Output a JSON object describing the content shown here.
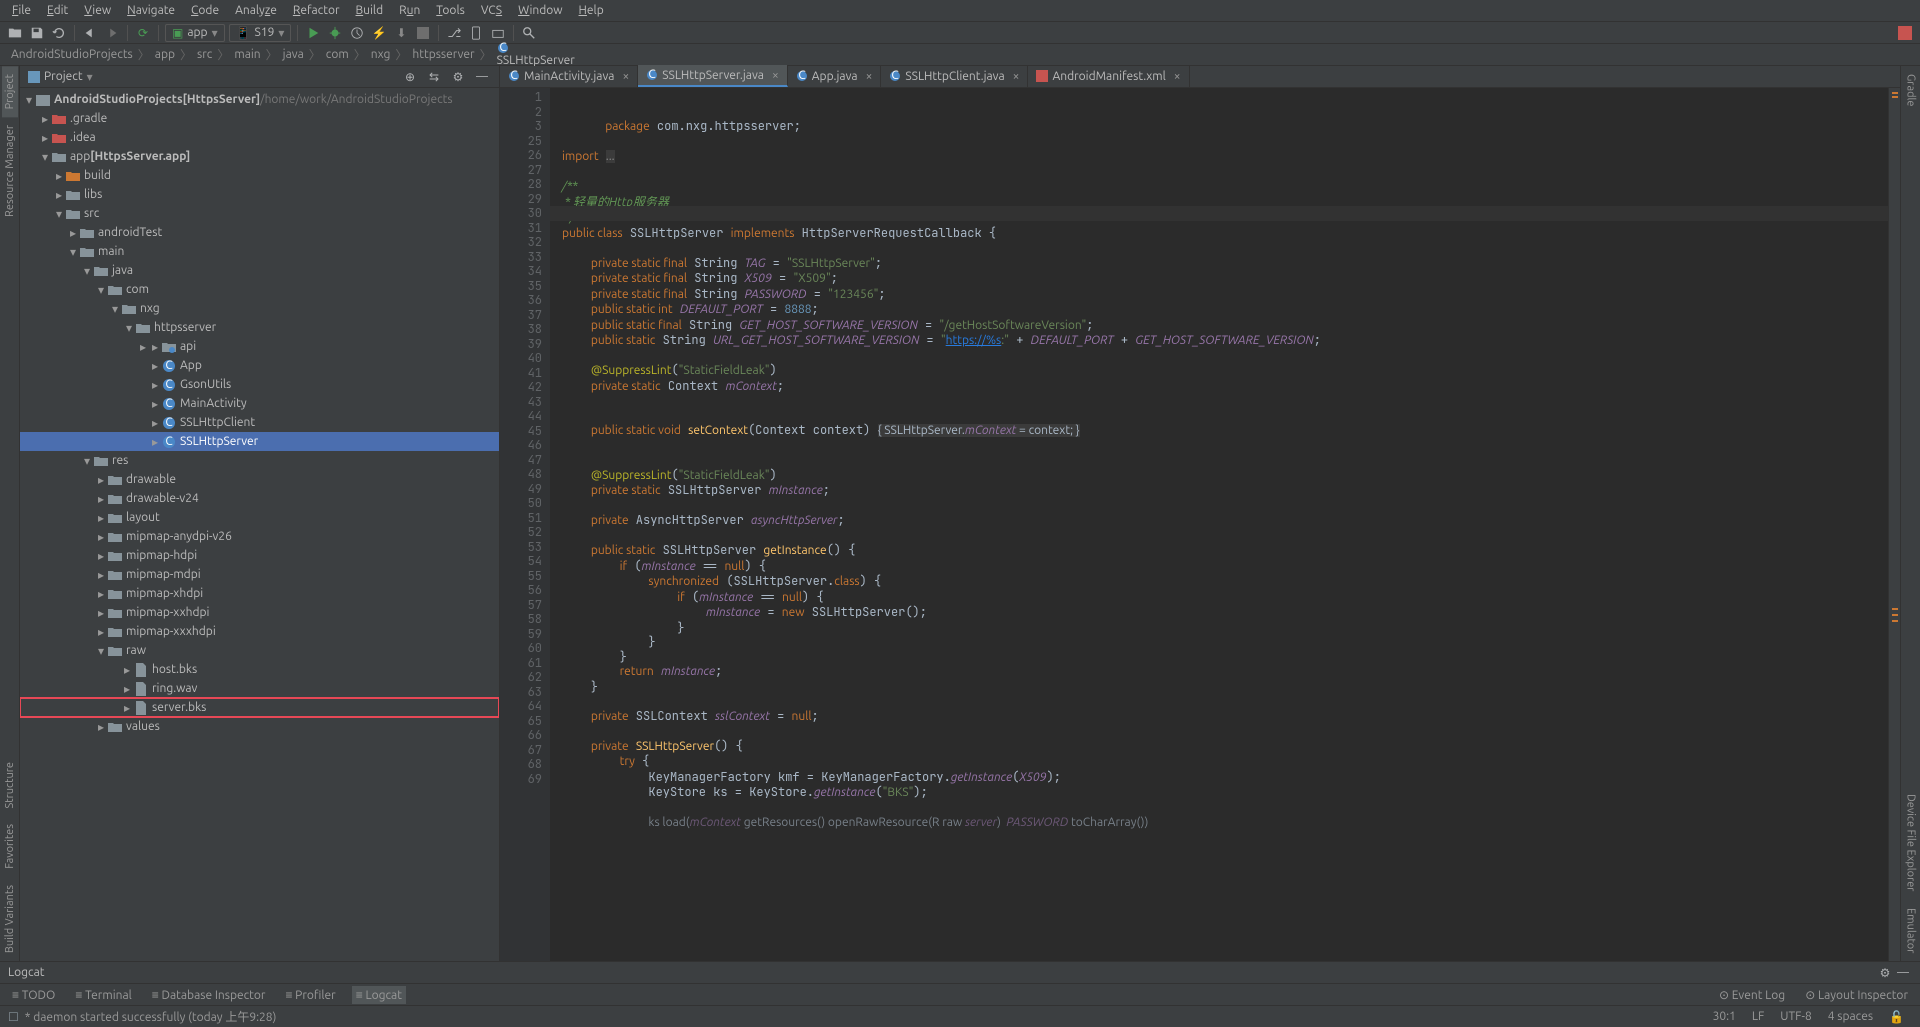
{
  "menu": [
    "File",
    "Edit",
    "View",
    "Navigate",
    "Code",
    "Analyze",
    "Refactor",
    "Build",
    "Run",
    "Tools",
    "VCS",
    "Window",
    "Help"
  ],
  "toolbar": {
    "run_config1": "app",
    "run_config2": "S19"
  },
  "breadcrumb": [
    "AndroidStudioProjects",
    "app",
    "src",
    "main",
    "java",
    "com",
    "nxg",
    "httpsserver",
    "SSLHttpServer"
  ],
  "project_panel": {
    "title": "Project",
    "root": {
      "label": "AndroidStudioProjects",
      "tag": "[HttpsServer]",
      "path": "/home/work/AndroidStudioProjects"
    },
    "tree": [
      {
        "d": 1,
        "t": "fex",
        "l": ".gradle"
      },
      {
        "d": 1,
        "t": "fex",
        "l": ".idea"
      },
      {
        "d": 1,
        "t": "mod",
        "l": "app",
        "tag": "[HttpsServer.app]",
        "open": true
      },
      {
        "d": 2,
        "t": "for",
        "l": "build"
      },
      {
        "d": 2,
        "t": "f",
        "l": "libs"
      },
      {
        "d": 2,
        "t": "f",
        "l": "src",
        "open": true
      },
      {
        "d": 3,
        "t": "f",
        "l": "androidTest"
      },
      {
        "d": 3,
        "t": "f",
        "l": "main",
        "open": true
      },
      {
        "d": 4,
        "t": "f",
        "l": "java",
        "open": true
      },
      {
        "d": 5,
        "t": "f",
        "l": "com",
        "open": true
      },
      {
        "d": 6,
        "t": "f",
        "l": "nxg",
        "open": true
      },
      {
        "d": 7,
        "t": "f",
        "l": "httpsserver",
        "open": true
      },
      {
        "d": 8,
        "t": "p",
        "l": "api"
      },
      {
        "d": 8,
        "t": "c",
        "l": "App"
      },
      {
        "d": 8,
        "t": "c",
        "l": "GsonUtils"
      },
      {
        "d": 8,
        "t": "c",
        "l": "MainActivity"
      },
      {
        "d": 8,
        "t": "c",
        "l": "SSLHttpClient"
      },
      {
        "d": 8,
        "t": "c",
        "l": "SSLHttpServer",
        "sel": true
      },
      {
        "d": 4,
        "t": "f",
        "l": "res",
        "open": true
      },
      {
        "d": 5,
        "t": "f",
        "l": "drawable"
      },
      {
        "d": 5,
        "t": "f",
        "l": "drawable-v24"
      },
      {
        "d": 5,
        "t": "f",
        "l": "layout"
      },
      {
        "d": 5,
        "t": "f",
        "l": "mipmap-anydpi-v26"
      },
      {
        "d": 5,
        "t": "f",
        "l": "mipmap-hdpi"
      },
      {
        "d": 5,
        "t": "f",
        "l": "mipmap-mdpi"
      },
      {
        "d": 5,
        "t": "f",
        "l": "mipmap-xhdpi"
      },
      {
        "d": 5,
        "t": "f",
        "l": "mipmap-xxhdpi"
      },
      {
        "d": 5,
        "t": "f",
        "l": "mipmap-xxxhdpi"
      },
      {
        "d": 5,
        "t": "f",
        "l": "raw",
        "open": true
      },
      {
        "d": 6,
        "t": "file",
        "l": "host.bks"
      },
      {
        "d": 6,
        "t": "file",
        "l": "ring.wav"
      },
      {
        "d": 6,
        "t": "file",
        "l": "server.bks",
        "hl": true
      },
      {
        "d": 5,
        "t": "f",
        "l": "values"
      }
    ]
  },
  "left_gutter": [
    "Project",
    "Resource Manager"
  ],
  "left_gutter_bottom": [
    "Structure",
    "Favorites",
    "Build Variants"
  ],
  "right_gutter": [
    "Gradle",
    "Device File Explorer",
    "Emulator"
  ],
  "tabs": [
    {
      "l": "MainActivity.java",
      "a": false,
      "i": "c"
    },
    {
      "l": "SSLHttpServer.java",
      "a": true,
      "i": "c"
    },
    {
      "l": "App.java",
      "a": false,
      "i": "c"
    },
    {
      "l": "SSLHttpClient.java",
      "a": false,
      "i": "c"
    },
    {
      "l": "AndroidManifest.xml",
      "a": false,
      "i": "x"
    }
  ],
  "line_numbers": [
    1,
    2,
    3,
    25,
    26,
    27,
    28,
    29,
    30,
    31,
    32,
    33,
    34,
    35,
    36,
    37,
    38,
    39,
    40,
    41,
    42,
    43,
    44,
    45,
    46,
    47,
    48,
    49,
    50,
    51,
    52,
    53,
    54,
    55,
    56,
    57,
    58,
    59,
    60,
    61,
    62,
    63,
    64,
    65,
    66,
    67,
    68,
    69
  ],
  "code_lines": [
    "<span class='kw'>package</span> com.nxg.httpsserver;",
    "",
    "<span class='kw'>import</span> <span style='background:#3b3b3b;color:#888'>...</span>",
    "",
    "<span class='com'>/**</span>",
    "<span class='com'> * 轻量的Http服务器</span>",
    "<span class='com'> */</span>",
    "<span class='kw'>public class</span> SSLHttpServer <span class='kw'>implements</span> HttpServerRequestCallback {",
    "",
    "    <span class='kw'>private static final</span> String <span class='fld'>TAG</span> = <span class='str'>\"SSLHttpServer\"</span>;",
    "    <span class='kw'>private static final</span> String <span class='fld'>X509</span> = <span class='str'>\"X509\"</span>;",
    "    <span class='kw'>private static final</span> String <span class='fld'>PASSWORD</span> = <span class='str'>\"123456\"</span>;",
    "    <span class='kw'>public static int</span> <span class='fld'>DEFAULT_PORT</span> = <span class='num'>8888</span>;",
    "    <span class='kw'>public static final</span> String <span class='fld'>GET_HOST_SOFTWARE_VERSION</span> = <span class='str'>\"/getHostSoftwareVersion\"</span>;",
    "    <span class='kw'>public static</span> String <span class='fld'>URL_GET_HOST_SOFTWARE_VERSION</span> = <span class='str'>\"<span class='url'>https://%s</span>:\"</span> + <span class='fld'>DEFAULT_PORT</span> + <span class='fld'>GET_HOST_SOFTWARE_VERSION</span>;",
    "",
    "    <span class='ann'>@SuppressLint</span>(<span class='str'>\"StaticFieldLeak\"</span>)",
    "    <span class='kw'>private static</span> Context <span class='fld'>mContext</span>;",
    "",
    "",
    "    <span class='kw'>public static void</span> <span class='mth'>setContext</span>(Context context) <span style='background:#3b3b3b'>{ SSLHttpServer.<span class='fld'>mContext</span> = context; }</span>",
    "",
    "",
    "    <span class='ann'>@SuppressLint</span>(<span class='str'>\"StaticFieldLeak\"</span>)",
    "    <span class='kw'>private static</span> SSLHttpServer <span class='fld'>mInstance</span>;",
    "",
    "    <span class='kw'>private</span> AsyncHttpServer <span class='fld'>asyncHttpServer</span>;",
    "",
    "    <span class='kw'>public static</span> SSLHttpServer <span class='mth'>getInstance</span>() {",
    "        <span class='kw'>if</span> (<span class='fld'>mInstance</span> == <span class='kw'>null</span>) {",
    "            <span class='kw'>synchronized</span> (SSLHttpServer.<span class='kw'>class</span>) {",
    "                <span class='kw'>if</span> (<span class='fld'>mInstance</span> == <span class='kw'>null</span>) {",
    "                    <span class='fld'>mInstance</span> = <span class='kw'>new</span> SSLHttpServer();",
    "                }",
    "            }",
    "        }",
    "        <span class='kw'>return</span> <span class='fld'>mInstance</span>;",
    "    }",
    "",
    "    <span class='kw'>private</span> SSLContext <span class='fld'>sslContext</span> = <span class='kw'>null</span>;",
    "",
    "    <span class='kw'>private</span> <span class='mth'>SSLHttpServer</span>() {",
    "        <span class='kw'>try</span> {",
    "            KeyManagerFactory kmf = KeyManagerFactory.<span class='fld'>getInstance</span>(<span class='fld'>X509</span>);",
    "            KeyStore ks = KeyStore.<span class='fld'>getInstance</span>(<span class='str'>\"BKS\"</span>);",
    "",
    "            <span style='opacity:.6'>ks load(<span class='fld'>mContext</span> getResources() openRawResource(R raw <span class='fld'>server</span>)  <span class='fld'>PASSWORD</span> toCharArray())</span>"
  ],
  "logcat_title": "Logcat",
  "bottom_tools": [
    {
      "l": "TODO",
      "a": false
    },
    {
      "l": "Terminal",
      "a": false
    },
    {
      "l": "Database Inspector",
      "a": false
    },
    {
      "l": "Profiler",
      "a": false
    },
    {
      "l": "Logcat",
      "a": true
    }
  ],
  "bottom_right": [
    "Event Log",
    "Layout Inspector"
  ],
  "status": {
    "msg": "* daemon started successfully (today 上午9:28)",
    "pos": "30:1",
    "le": "LF",
    "enc": "UTF-8",
    "indent": "4 spaces"
  }
}
